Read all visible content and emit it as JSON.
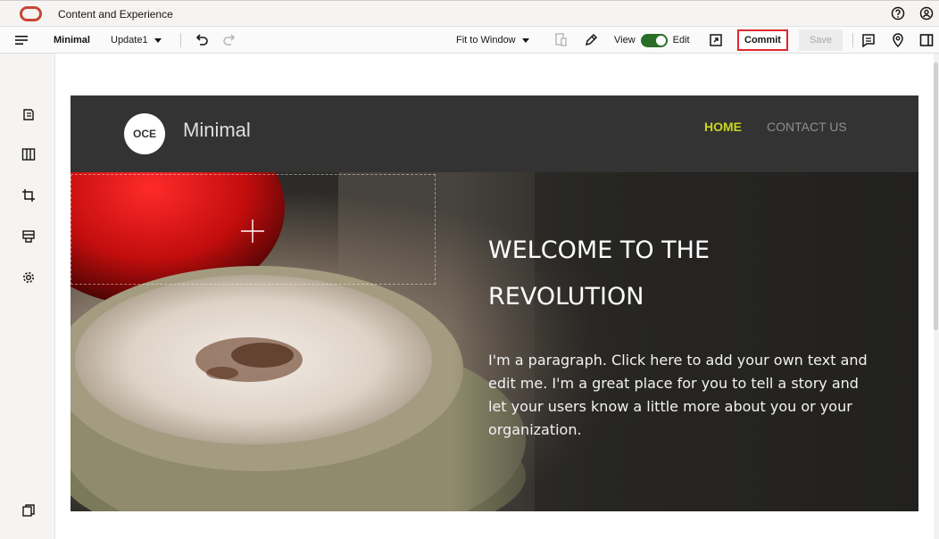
{
  "app": {
    "title": "Content and Experience",
    "brand_color": "#c74634"
  },
  "titlebar": {
    "help_icon": "help-circle-icon",
    "user_icon": "user-avatar-icon"
  },
  "toolbar": {
    "menu_icon": "hamburger-menu-icon",
    "site_name": "Minimal",
    "update_label": "Update1",
    "undo_icon": "undo-icon",
    "redo_icon": "redo-icon",
    "fit_label": "Fit to Window",
    "device_icon": "device-preview-icon",
    "edit_icon": "pencil-icon",
    "view_label": "View",
    "edit_label": "Edit",
    "toggle_state": "Edit",
    "open_icon": "open-external-icon",
    "commit_label": "Commit",
    "save_label": "Save",
    "comments_icon": "comments-icon",
    "location_icon": "location-pin-icon",
    "panel_icon": "side-panel-icon",
    "toggle_color": "#2a6e26",
    "commit_border_color": "#e0282e"
  },
  "rail": {
    "items": [
      "pages-icon",
      "layout-columns-icon",
      "crop-icon",
      "component-icon",
      "settings-gear-icon"
    ],
    "bottom_item": "copy-icon"
  },
  "site": {
    "logo_text": "OCE",
    "name": "Minimal",
    "nav": [
      {
        "label": "HOME",
        "active": true
      },
      {
        "label": "CONTACT US",
        "active": false
      }
    ],
    "active_nav_color": "#c9d520",
    "header_color": "#333333"
  },
  "hero": {
    "title": "WELCOME TO THE REVOLUTION",
    "paragraph": "I'm a paragraph. Click here to add your own text and edit me. I'm a great place for you to tell a story and let your users know a little more about you or your organization.",
    "add_icon": "plus-icon"
  }
}
